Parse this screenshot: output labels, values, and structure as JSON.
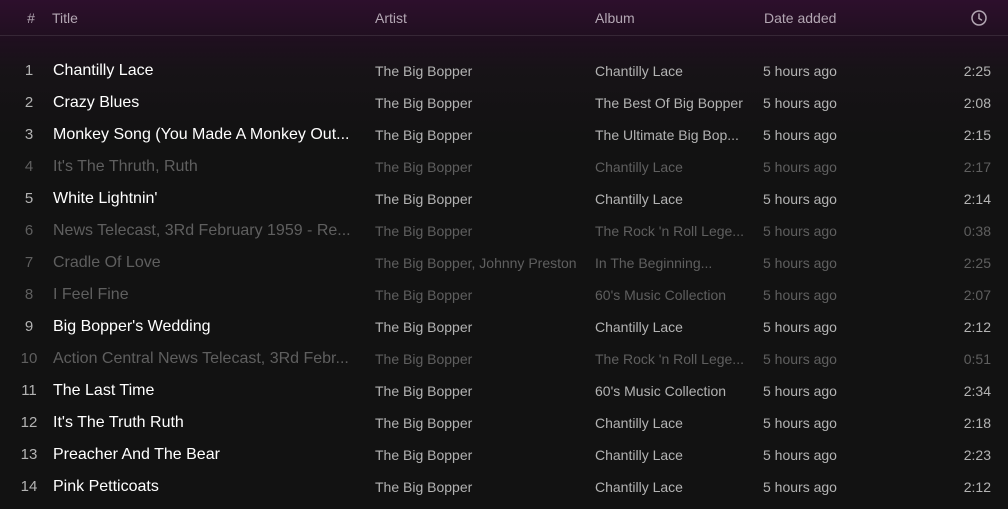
{
  "header": {
    "num": "#",
    "title": "Title",
    "artist": "Artist",
    "album": "Album",
    "date_added": "Date added",
    "duration_icon": "clock-icon"
  },
  "tracks": [
    {
      "num": "1",
      "title": "Chantilly Lace",
      "artist": "The Big Bopper",
      "album": "Chantilly Lace",
      "date_added": "5 hours ago",
      "duration": "2:25",
      "dimmed": false
    },
    {
      "num": "2",
      "title": "Crazy Blues",
      "artist": "The Big Bopper",
      "album": "The Best Of Big Bopper",
      "date_added": "5 hours ago",
      "duration": "2:08",
      "dimmed": false
    },
    {
      "num": "3",
      "title": "Monkey Song (You Made A Monkey Out...",
      "artist": "The Big Bopper",
      "album": "The Ultimate Big Bop...",
      "date_added": "5 hours ago",
      "duration": "2:15",
      "dimmed": false
    },
    {
      "num": "4",
      "title": "It's The Thruth, Ruth",
      "artist": "The Big Bopper",
      "album": "Chantilly Lace",
      "date_added": "5 hours ago",
      "duration": "2:17",
      "dimmed": true
    },
    {
      "num": "5",
      "title": "White Lightnin'",
      "artist": "The Big Bopper",
      "album": "Chantilly Lace",
      "date_added": "5 hours ago",
      "duration": "2:14",
      "dimmed": false
    },
    {
      "num": "6",
      "title": "News Telecast, 3Rd February 1959 - Re...",
      "artist": "The Big Bopper",
      "album": "The Rock 'n Roll Lege...",
      "date_added": "5 hours ago",
      "duration": "0:38",
      "dimmed": true
    },
    {
      "num": "7",
      "title": "Cradle Of Love",
      "artist": "The Big Bopper, Johnny Preston",
      "album": "In The Beginning...",
      "date_added": "5 hours ago",
      "duration": "2:25",
      "dimmed": true
    },
    {
      "num": "8",
      "title": "I Feel Fine",
      "artist": "The Big Bopper",
      "album": "60's Music Collection",
      "date_added": "5 hours ago",
      "duration": "2:07",
      "dimmed": true
    },
    {
      "num": "9",
      "title": "Big Bopper's Wedding",
      "artist": "The Big Bopper",
      "album": "Chantilly Lace",
      "date_added": "5 hours ago",
      "duration": "2:12",
      "dimmed": false
    },
    {
      "num": "10",
      "title": "Action Central News Telecast, 3Rd Febr...",
      "artist": "The Big Bopper",
      "album": "The Rock 'n Roll Lege...",
      "date_added": "5 hours ago",
      "duration": "0:51",
      "dimmed": true
    },
    {
      "num": "11",
      "title": "The Last Time",
      "artist": "The Big Bopper",
      "album": "60's Music Collection",
      "date_added": "5 hours ago",
      "duration": "2:34",
      "dimmed": false
    },
    {
      "num": "12",
      "title": "It's The Truth Ruth",
      "artist": "The Big Bopper",
      "album": "Chantilly Lace",
      "date_added": "5 hours ago",
      "duration": "2:18",
      "dimmed": false
    },
    {
      "num": "13",
      "title": "Preacher And The Bear",
      "artist": "The Big Bopper",
      "album": "Chantilly Lace",
      "date_added": "5 hours ago",
      "duration": "2:23",
      "dimmed": false
    },
    {
      "num": "14",
      "title": "Pink Petticoats",
      "artist": "The Big Bopper",
      "album": "Chantilly Lace",
      "date_added": "5 hours ago",
      "duration": "2:12",
      "dimmed": false
    }
  ]
}
